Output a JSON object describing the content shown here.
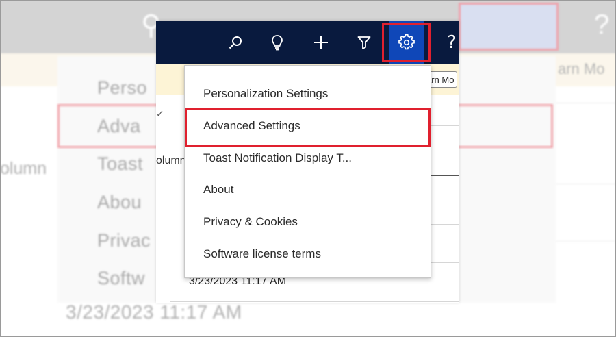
{
  "background": {
    "items": [
      "Perso",
      "Adva",
      "Toast",
      "Abou",
      "Privac",
      "Softw"
    ],
    "learn_more": "arn Mo",
    "column_text": "olumn",
    "date": "3/23/2023 11:17 AM"
  },
  "navbar": {
    "buttons": [
      {
        "icon": "search-icon"
      },
      {
        "icon": "lightbulb-icon"
      },
      {
        "icon": "plus-icon"
      },
      {
        "icon": "filter-icon"
      },
      {
        "icon": "gear-icon",
        "active": true
      },
      {
        "icon": "help-icon",
        "glyph": "?"
      }
    ]
  },
  "notification": {
    "learn_more": "arn Mo"
  },
  "content": {
    "column_label": "olumn",
    "check_glyph": "✓",
    "date": "3/23/2023 11:17 AM"
  },
  "settings_menu": {
    "items": [
      "Personalization Settings",
      "Advanced Settings",
      "Toast Notification Display T...",
      "About",
      "Privacy & Cookies",
      "Software license terms"
    ],
    "highlighted": "Advanced Settings"
  },
  "colors": {
    "navbar": "#091a3e",
    "gear_active": "#0f47b8",
    "highlight": "#e0202e",
    "notification": "#fdf4d6"
  }
}
